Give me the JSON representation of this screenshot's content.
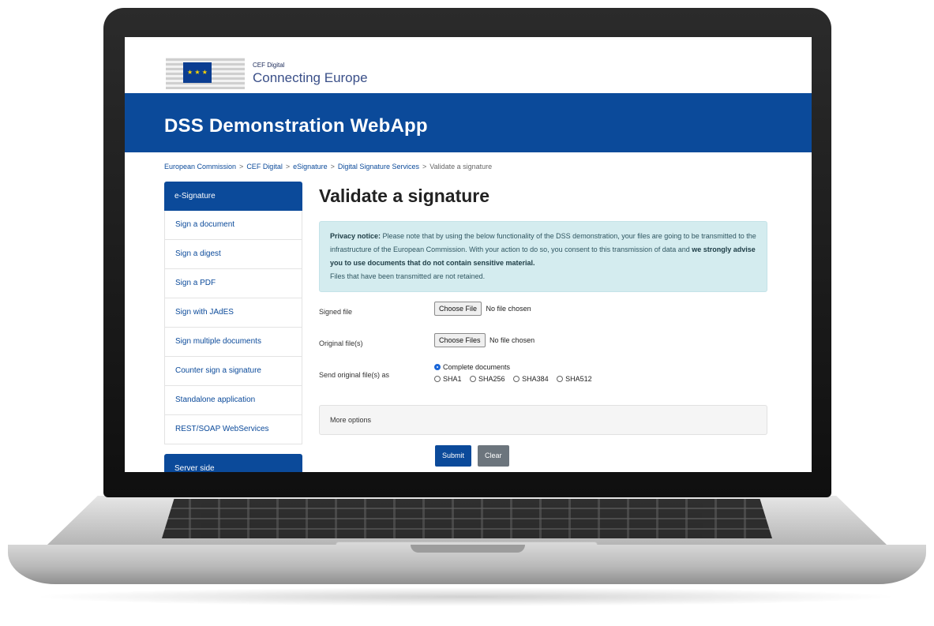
{
  "logo": {
    "small": "CEF Digital",
    "big": "Connecting Europe",
    "flag_stars": "★ ★ ★"
  },
  "banner": {
    "title": "DSS Demonstration WebApp"
  },
  "breadcrumb": {
    "items": [
      "European Commission",
      "CEF Digital",
      "eSignature",
      "Digital Signature Services"
    ],
    "current": "Validate a signature",
    "separator": ">"
  },
  "sidebar": {
    "heading": "e-Signature",
    "items": [
      "Sign a document",
      "Sign a digest",
      "Sign a PDF",
      "Sign with JAdES",
      "Sign multiple documents",
      "Counter sign a signature",
      "Standalone application",
      "REST/SOAP WebServices"
    ],
    "heading2": "Server side"
  },
  "main": {
    "title": "Validate a signature",
    "notice": {
      "bold_lead": "Privacy notice:",
      "text1": " Please note that by using the below functionality of the DSS demonstration, your files are going to be transmitted to the infrastructure of the European Commission. With your action to do so, you consent to this transmission of data and ",
      "bold_mid": "we strongly advise you to use documents that do not contain sensitive material.",
      "text2": "Files that have been transmitted are not retained."
    },
    "signed_file": {
      "label": "Signed file",
      "button": "Choose File",
      "status": "No file chosen"
    },
    "original_files": {
      "label": "Original file(s)",
      "button": "Choose Files",
      "status": "No file chosen"
    },
    "send_as": {
      "label": "Send original file(s) as",
      "selected": "Complete documents",
      "options": [
        "SHA1",
        "SHA256",
        "SHA384",
        "SHA512"
      ]
    },
    "more_options": "More options",
    "submit": "Submit",
    "clear": "Clear"
  },
  "colors": {
    "brand_blue": "#0b4a9a",
    "notice_bg": "#d4ecef",
    "clear_grey": "#6c757d"
  }
}
